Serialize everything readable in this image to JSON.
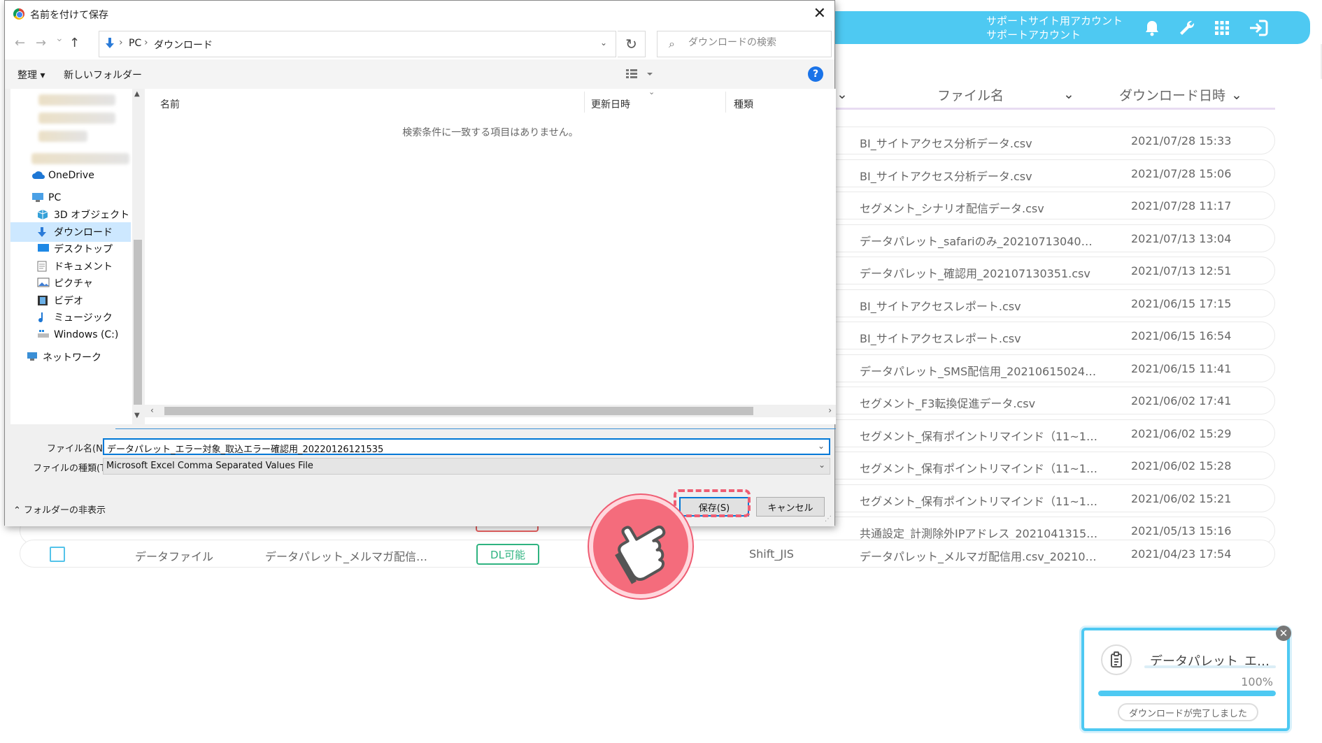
{
  "dialog": {
    "title": "名前を付けて保存",
    "close": "✕",
    "nav": {
      "back": "←",
      "forward": "→",
      "recent": "⌄",
      "up": "↑"
    },
    "breadcrumb": [
      "PC",
      "ダウンロード"
    ],
    "breadcrumb_sep": "›",
    "search_placeholder": "ダウンロードの検索",
    "commands": {
      "organize": "整理 ▾",
      "new_folder": "新しいフォルダー"
    },
    "nav_items": [
      {
        "label": "OneDrive"
      },
      {
        "label": "PC"
      },
      {
        "label": "3D オブジェクト"
      },
      {
        "label": "ダウンロード"
      },
      {
        "label": "デスクトップ"
      },
      {
        "label": "ドキュメント"
      },
      {
        "label": "ピクチャ"
      },
      {
        "label": "ビデオ"
      },
      {
        "label": "ミュージック"
      },
      {
        "label": "Windows (C:)"
      },
      {
        "label": "ネットワーク"
      }
    ],
    "columns": {
      "name": "名前",
      "modified": "更新日時",
      "type": "種類"
    },
    "empty_message": "検索条件に一致する項目はありません。",
    "filename_label": "ファイル名(N):",
    "filename_value": "データパレット_エラー対象_取込エラー確認用_20220126121535",
    "filetype_label": "ファイルの種類(T):",
    "filetype_value": "Microsoft Excel Comma Separated Values File",
    "hide_folders": "フォルダーの非表示",
    "save_button": "保存(S)",
    "cancel_button": "キャンセル"
  },
  "app": {
    "account_line1": "サポートサイト用アカウント",
    "account_line2": "サポートアカウント",
    "col_filename": "ファイル名",
    "col_download_date": "ダウンロード日時",
    "rows": [
      {
        "file": "BI_サイトアクセス分析データ.csv",
        "date": "2021/07/28 15:33"
      },
      {
        "file": "BI_サイトアクセス分析データ.csv",
        "date": "2021/07/28 15:06"
      },
      {
        "file": "セグメント_シナリオ配信データ.csv",
        "date": "2021/07/28 11:17"
      },
      {
        "file": "データパレット_safariのみ_20210713040…",
        "date": "2021/07/13 13:04"
      },
      {
        "file": "データパレット_確認用_202107130351.csv",
        "date": "2021/07/13 12:51"
      },
      {
        "file": "BI_サイトアクセスレポート.csv",
        "date": "2021/06/15 17:15"
      },
      {
        "file": "BI_サイトアクセスレポート.csv",
        "date": "2021/06/15 16:54"
      },
      {
        "file": "データパレット_SMS配信用_20210615024…",
        "date": "2021/06/15 11:41"
      },
      {
        "file": "セグメント_F3転換促進データ.csv",
        "date": "2021/06/02 17:41"
      },
      {
        "file": "セグメント_保有ポイントリマインド（11~1…",
        "date": "2021/06/02 15:29"
      },
      {
        "file": "セグメント_保有ポイントリマインド（11~1…",
        "date": "2021/06/02 15:28"
      },
      {
        "file": "セグメント_保有ポイントリマインド（11~1…",
        "date": "2021/06/02 15:21"
      },
      {
        "file": "共通設定_計測除外IPアドレス_2021041315…",
        "date": "2021/05/13 15:16"
      }
    ],
    "last_row": {
      "type": "データファイル",
      "name": "データパレット_メルマガ配信…",
      "status": "DL可能",
      "encoding": "Shift_JIS",
      "file": "データパレット_メルマガ配信用.csv_20210…",
      "date": "2021/04/23 17:54"
    }
  },
  "toast": {
    "file_name": "データパレット_エ…",
    "percent": "100%",
    "progress": 1.0,
    "status": "ダウンロードが完了しました",
    "close": "✕"
  }
}
